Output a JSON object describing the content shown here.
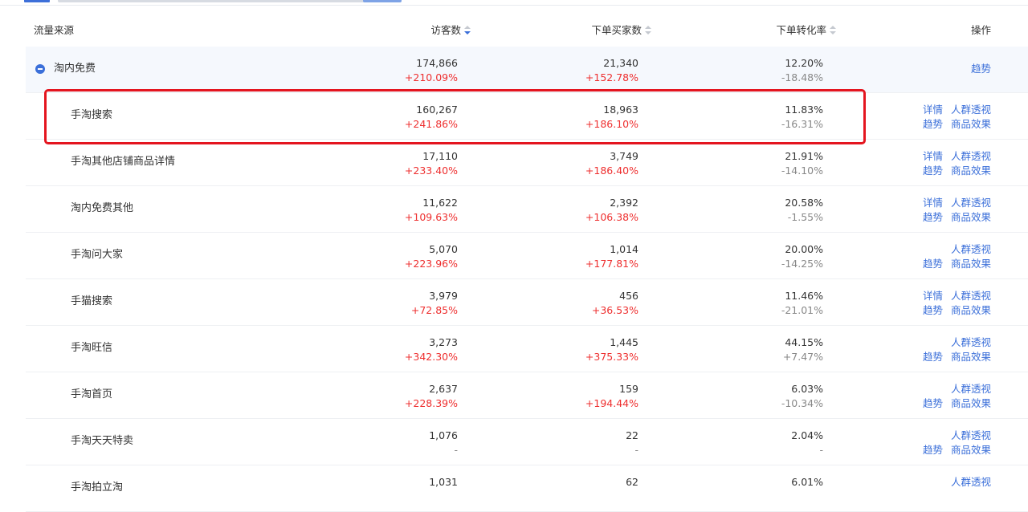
{
  "headers": {
    "source": "流量来源",
    "visitors": "访客数",
    "buyers": "下单买家数",
    "conversion": "下单转化率",
    "actions": "操作"
  },
  "parent": {
    "name": "淘内免费",
    "visitors": "174,866",
    "visitors_delta": "+210.09%",
    "buyers": "21,340",
    "buyers_delta": "+152.78%",
    "conversion": "12.20%",
    "conversion_delta": "-18.48%",
    "action": "趋势"
  },
  "action_labels": {
    "detail": "详情",
    "crowd": "人群透视",
    "trend": "趋势",
    "product": "商品效果"
  },
  "rows": [
    {
      "name": "手淘搜索",
      "visitors": "160,267",
      "visitors_delta": "+241.86%",
      "buyers": "18,963",
      "buyers_delta": "+186.10%",
      "conversion": "11.83%",
      "conversion_delta": "-16.31%"
    },
    {
      "name": "手淘其他店铺商品详情",
      "visitors": "17,110",
      "visitors_delta": "+233.40%",
      "buyers": "3,749",
      "buyers_delta": "+186.40%",
      "conversion": "21.91%",
      "conversion_delta": "-14.10%"
    },
    {
      "name": "淘内免费其他",
      "visitors": "11,622",
      "visitors_delta": "+109.63%",
      "buyers": "2,392",
      "buyers_delta": "+106.38%",
      "conversion": "20.58%",
      "conversion_delta": "-1.55%"
    },
    {
      "name": "手淘问大家",
      "visitors": "5,070",
      "visitors_delta": "+223.96%",
      "buyers": "1,014",
      "buyers_delta": "+177.81%",
      "conversion": "20.00%",
      "conversion_delta": "-14.25%"
    },
    {
      "name": "手猫搜索",
      "visitors": "3,979",
      "visitors_delta": "+72.85%",
      "buyers": "456",
      "buyers_delta": "+36.53%",
      "conversion": "11.46%",
      "conversion_delta": "-21.01%"
    },
    {
      "name": "手淘旺信",
      "visitors": "3,273",
      "visitors_delta": "+342.30%",
      "buyers": "1,445",
      "buyers_delta": "+375.33%",
      "conversion": "44.15%",
      "conversion_delta": "+7.47%"
    },
    {
      "name": "手淘首页",
      "visitors": "2,637",
      "visitors_delta": "+228.39%",
      "buyers": "159",
      "buyers_delta": "+194.44%",
      "conversion": "6.03%",
      "conversion_delta": "-10.34%"
    },
    {
      "name": "手淘天天特卖",
      "visitors": "1,076",
      "visitors_delta": "-",
      "buyers": "22",
      "buyers_delta": "-",
      "conversion": "2.04%",
      "conversion_delta": "-"
    },
    {
      "name": "手淘拍立淘",
      "visitors": "1,031",
      "visitors_delta": "",
      "buyers": "62",
      "buyers_delta": "",
      "conversion": "6.01%",
      "conversion_delta": ""
    }
  ]
}
